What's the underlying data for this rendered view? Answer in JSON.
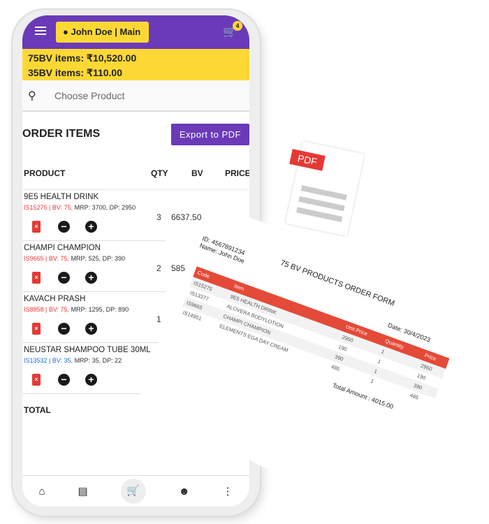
{
  "header": {
    "user": "John Doe | Main",
    "cart_count": "4"
  },
  "bv_summary": [
    "75BV items: ₹10,520.00",
    "35BV items: ₹110.00"
  ],
  "search": {
    "placeholder": "Choose Product"
  },
  "section": {
    "title": "ORDER ITEMS",
    "export_label": "Export to PDF"
  },
  "table": {
    "headers": [
      "PRODUCT",
      "QTY",
      "BV",
      "PRICE"
    ],
    "rows": [
      {
        "name": "9E5 HEALTH DRINK",
        "code": "IS15275 | BV: 75,",
        "info": " MRP: 3700, DP: 2950",
        "qty": "3",
        "bv": "6637.50",
        "color": "#e53935"
      },
      {
        "name": "CHAMPI CHAMPION",
        "code": "IS9665 | BV: 75,",
        "info": " MRP: 525, DP: 390",
        "qty": "2",
        "bv": "585.",
        "color": "#e53935"
      },
      {
        "name": "KAVACH PRASH",
        "code": "IS8858 | BV: 75,",
        "info": " MRP: 1295, DP: 890",
        "qty": "1",
        "bv": "",
        "color": "#e53935"
      },
      {
        "name": "NEUSTAR SHAMPOO TUBE 30ML",
        "code": "IS13532 | BV: 35,",
        "info": " MRP: 35, DP: 22",
        "qty": "",
        "bv": "",
        "color": "#1e6fd9"
      }
    ],
    "total_label": "TOTAL"
  },
  "bottom_nav": [
    "home-icon",
    "list-icon",
    "cart-icon",
    "people-icon",
    "more-icon"
  ],
  "pdf_icon_label": "PDF",
  "pdf_doc": {
    "id": "ID:  4567891234",
    "name": "Name: John Doe",
    "title": "75 BV PRODUCTS ORDER FORM",
    "date": "Date: 30/4/2023",
    "headers": [
      "Code",
      "Item",
      "Unit Price",
      "Quantity",
      "Price"
    ],
    "rows": [
      [
        "IS15275",
        "9E5 HEALTH DRINK",
        "2950",
        "1",
        "2950"
      ],
      [
        "IS13377",
        "ALOVERA BODYLOTION",
        "190",
        "1",
        "190"
      ],
      [
        "IS9665",
        "CHAMPI CHAMPION",
        "390",
        "1",
        "390"
      ],
      [
        "IS14951",
        "ELEMENTS EGA DAY CREAM",
        "485",
        "1",
        "485"
      ]
    ],
    "total": "Total Amount : 4015.00"
  },
  "colors": {
    "primary": "#6a3ab8",
    "yellow": "#fdd835",
    "red": "#e44a38"
  }
}
